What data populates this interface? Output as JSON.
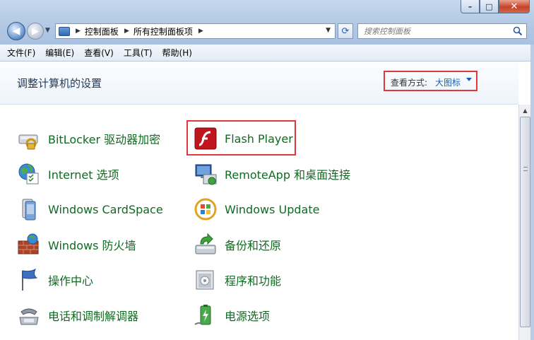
{
  "window": {
    "minimize_glyph": "–",
    "maximize_glyph": "□",
    "close_glyph": "✕"
  },
  "navigation": {
    "back_glyph": "◀",
    "forward_glyph": "▶",
    "history_glyph": "▼"
  },
  "address": {
    "crumbs": [
      "控制面板",
      "所有控制面板项"
    ],
    "separator": "▶",
    "dropdown_glyph": "▼",
    "refresh_glyph": "⟳"
  },
  "search": {
    "placeholder": "搜索控制面板"
  },
  "menu": {
    "items": [
      "文件(F)",
      "编辑(E)",
      "查看(V)",
      "工具(T)",
      "帮助(H)"
    ]
  },
  "content": {
    "title": "调整计算机的设置",
    "view_label": "查看方式:",
    "view_value": "大图标"
  },
  "items": [
    {
      "label": "BitLocker 驱动器加密",
      "icon": "bitlocker-icon"
    },
    {
      "label": "Flash Player",
      "icon": "flash-player-icon"
    },
    {
      "label": "Internet 选项",
      "icon": "internet-options-icon"
    },
    {
      "label": "RemoteApp 和桌面连接",
      "icon": "remoteapp-icon"
    },
    {
      "label": "Windows CardSpace",
      "icon": "cardspace-icon"
    },
    {
      "label": "Windows Update",
      "icon": "windows-update-icon"
    },
    {
      "label": "Windows 防火墙",
      "icon": "firewall-icon"
    },
    {
      "label": "备份和还原",
      "icon": "backup-restore-icon"
    },
    {
      "label": "操作中心",
      "icon": "action-center-icon"
    },
    {
      "label": "程序和功能",
      "icon": "programs-features-icon"
    },
    {
      "label": "电话和调制解调器",
      "icon": "phone-modem-icon"
    },
    {
      "label": "电源选项",
      "icon": "power-options-icon"
    }
  ],
  "colors": {
    "link_green": "#0e6b20",
    "highlight_red": "#e0383a",
    "view_blue": "#1a5fb4"
  }
}
